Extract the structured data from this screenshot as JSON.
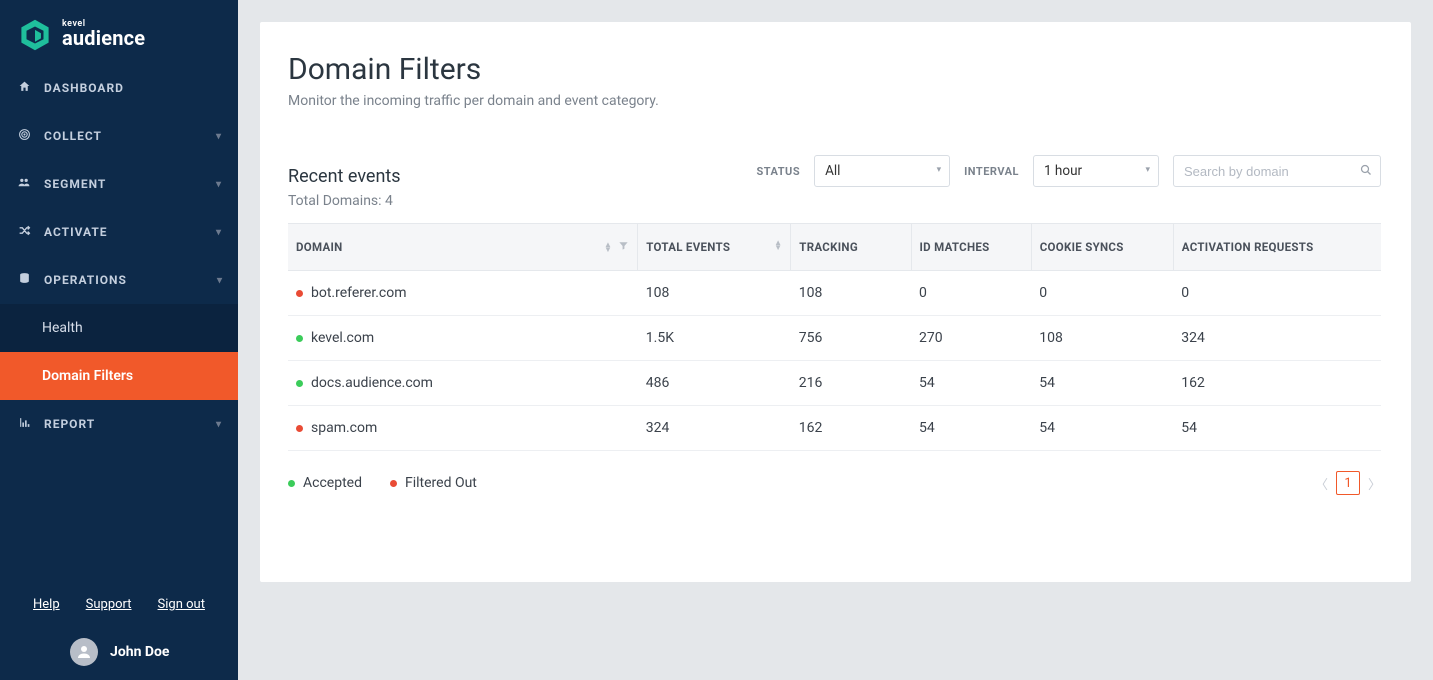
{
  "brand": {
    "company": "kevel",
    "product": "audience"
  },
  "sidebar": {
    "items": [
      {
        "label": "DASHBOARD"
      },
      {
        "label": "COLLECT"
      },
      {
        "label": "SEGMENT"
      },
      {
        "label": "ACTIVATE"
      },
      {
        "label": "OPERATIONS"
      },
      {
        "label": "REPORT"
      }
    ],
    "operations_sub": [
      {
        "label": "Health"
      },
      {
        "label": "Domain Filters"
      }
    ],
    "footer_links": {
      "help": "Help",
      "support": "Support",
      "signout": "Sign out"
    },
    "user_name": "John Doe"
  },
  "page": {
    "title": "Domain Filters",
    "subtitle": "Monitor the incoming traffic per domain and event category.",
    "section_title": "Recent events",
    "total_domains_label": "Total Domains: 4",
    "status_label": "STATUS",
    "interval_label": "INTERVAL",
    "status_value": "All",
    "interval_value": "1 hour",
    "search_placeholder": "Search by domain"
  },
  "table": {
    "headers": {
      "domain": "DOMAIN",
      "total": "TOTAL EVENTS",
      "tracking": "TRACKING",
      "id_matches": "ID MATCHES",
      "cookie_syncs": "COOKIE SYNCS",
      "activation": "ACTIVATION REQUESTS"
    },
    "rows": [
      {
        "status": "red",
        "domain": "bot.referer.com",
        "total": "108",
        "tracking": "108",
        "id_matches": "0",
        "cookie_syncs": "0",
        "activation": "0"
      },
      {
        "status": "green",
        "domain": "kevel.com",
        "total": "1.5K",
        "tracking": "756",
        "id_matches": "270",
        "cookie_syncs": "108",
        "activation": "324"
      },
      {
        "status": "green",
        "domain": "docs.audience.com",
        "total": "486",
        "tracking": "216",
        "id_matches": "54",
        "cookie_syncs": "54",
        "activation": "162"
      },
      {
        "status": "red",
        "domain": "spam.com",
        "total": "324",
        "tracking": "162",
        "id_matches": "54",
        "cookie_syncs": "54",
        "activation": "54"
      }
    ]
  },
  "legend": {
    "accepted": "Accepted",
    "filtered": "Filtered Out"
  },
  "pager": {
    "current": "1"
  }
}
